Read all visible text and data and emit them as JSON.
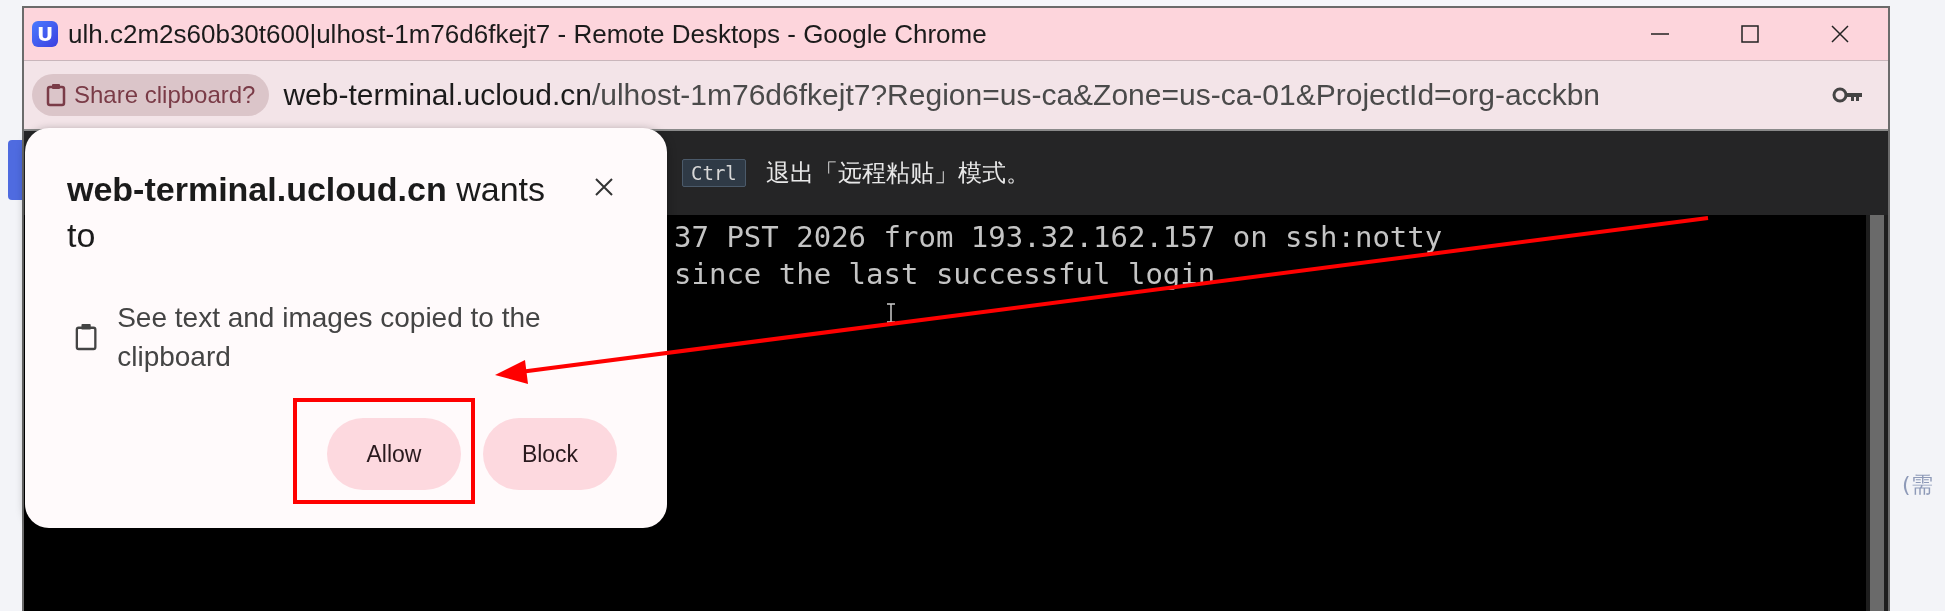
{
  "window": {
    "app_icon_letter": "U",
    "title": "ulh.c2m2s60b30t600|ulhost-1m76d6fkejt7 - Remote Desktops - Google Chrome"
  },
  "address_bar": {
    "chip": "Share clipboard?",
    "url_host": "web-terminal.ucloud.cn",
    "url_rest": "/ulhost-1m76d6fkejt7?Region=us-ca&Zone=us-ca-01&ProjectId=org-acckbn"
  },
  "toolbar": {
    "key": "Ctrl",
    "hint": "退出「远程粘贴」模式。"
  },
  "terminal": {
    "lines": [
      "37 PST 2026 from 193.32.162.157 on ssh:notty",
      "since the last successful login"
    ]
  },
  "permission_popup": {
    "title": "**web-terminal.ucloud.cn** wants to",
    "permission": "See text and images copied to the clipboard",
    "buttons": [
      {
        "label": "Allow",
        "annotated": true
      },
      {
        "label": "Block",
        "annotated": false
      }
    ]
  },
  "background_page": {
    "text": "(需"
  }
}
